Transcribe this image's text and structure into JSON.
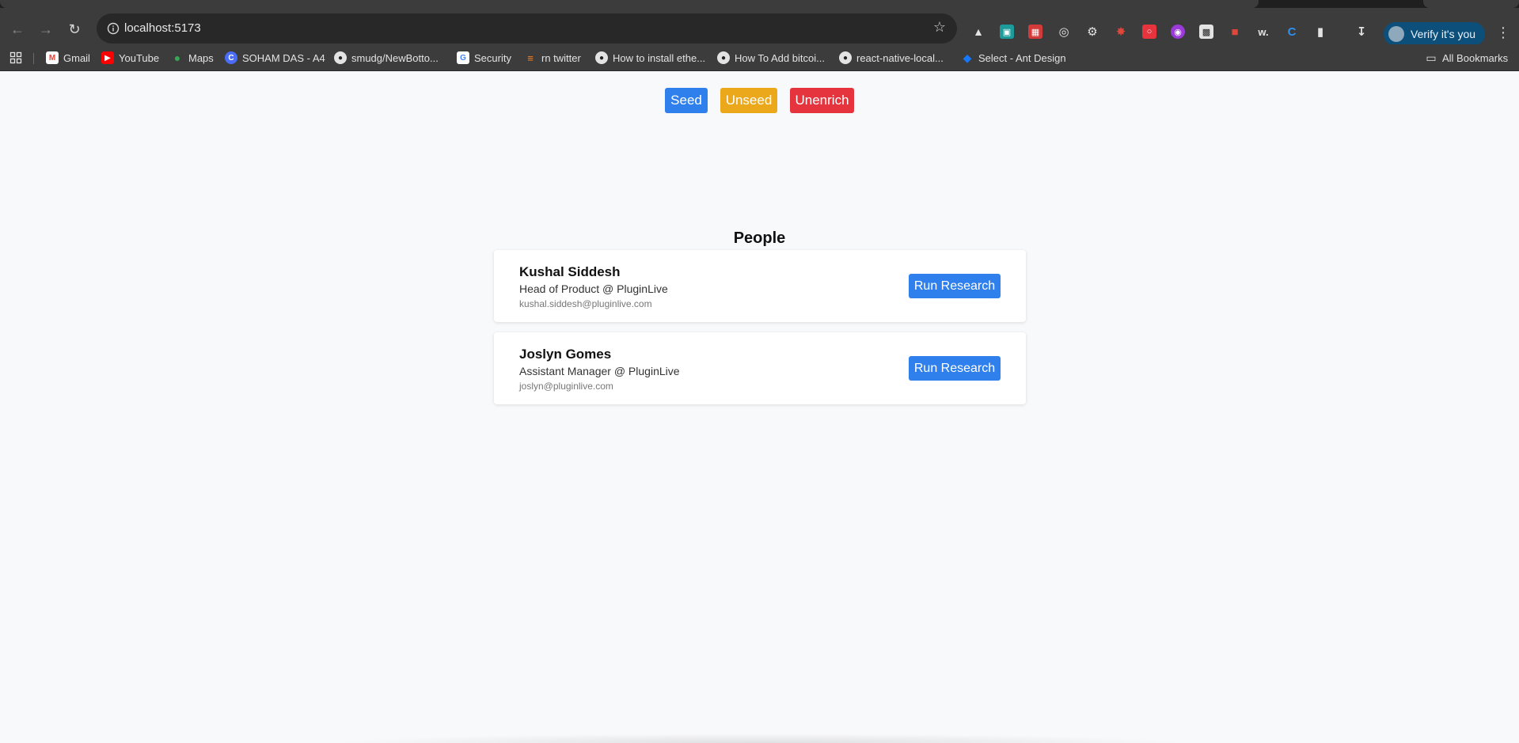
{
  "browser": {
    "url": "localhost:5173",
    "verify_label": "Verify it's you",
    "bookmarks": [
      {
        "label": "Gmail",
        "icon": "gmail-icon",
        "color": "#ea4335"
      },
      {
        "label": "YouTube",
        "icon": "youtube-icon",
        "color": "#ff0000"
      },
      {
        "label": "Maps",
        "icon": "maps-icon",
        "color": "#34a853"
      },
      {
        "label": "SOHAM DAS - A4",
        "icon": "site-icon",
        "color": "#4a6cf7"
      },
      {
        "label": "smudg/NewBotto...",
        "icon": "github-icon",
        "color": "#e3e3e3"
      },
      {
        "label": "Security",
        "icon": "google-icon",
        "color": "#4285f4"
      },
      {
        "label": "rn twitter",
        "icon": "stack-icon",
        "color": "#f48024"
      },
      {
        "label": "How to install ethe...",
        "icon": "github-icon",
        "color": "#e3e3e3"
      },
      {
        "label": "How To Add bitcoi...",
        "icon": "github-icon",
        "color": "#e3e3e3"
      },
      {
        "label": "react-native-local...",
        "icon": "github-icon",
        "color": "#e3e3e3"
      },
      {
        "label": "Select - Ant Design",
        "icon": "antd-icon",
        "color": "#1677ff"
      }
    ],
    "all_bookmarks_label": "All Bookmarks"
  },
  "actions": {
    "seed": "Seed",
    "unseed": "Unseed",
    "unenrich": "Unenrich"
  },
  "people": {
    "title": "People",
    "run_label": "Run Research",
    "items": [
      {
        "name": "Kushal Siddesh",
        "role": "Head of Product @ PluginLive",
        "email": "kushal.siddesh@pluginlive.com"
      },
      {
        "name": "Joslyn Gomes",
        "role": "Assistant Manager @ PluginLive",
        "email": "joslyn@pluginlive.com"
      }
    ]
  },
  "colors": {
    "primary": "#2f80ed",
    "warning": "#eaa81a",
    "danger": "#e5343e",
    "background": "#f8f9fb"
  }
}
